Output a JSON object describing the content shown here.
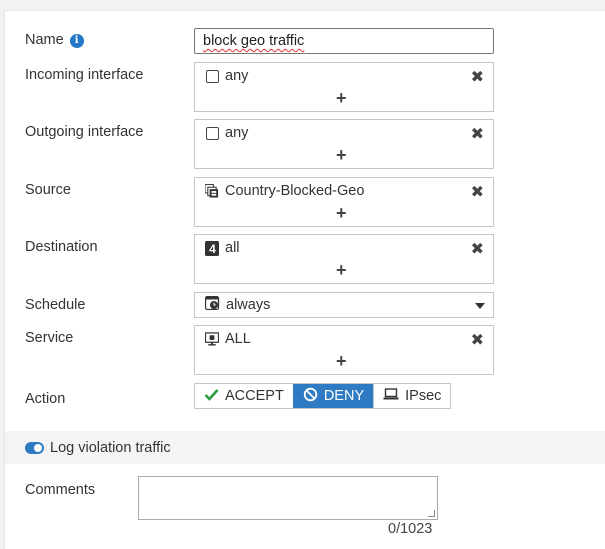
{
  "fields": {
    "name_label": "Name",
    "name_value": "block geo traffic",
    "incoming_label": "Incoming interface",
    "incoming_value": "any",
    "outgoing_label": "Outgoing interface",
    "outgoing_value": "any",
    "source_label": "Source",
    "source_value": "Country-Blocked-Geo",
    "destination_label": "Destination",
    "destination_value": "all",
    "schedule_label": "Schedule",
    "schedule_value": "always",
    "service_label": "Service",
    "service_value": "ALL",
    "action_label": "Action"
  },
  "action_options": [
    {
      "label": "ACCEPT",
      "icon": "check-icon",
      "selected": false
    },
    {
      "label": "DENY",
      "icon": "deny-icon",
      "selected": true
    },
    {
      "label": "IPsec",
      "icon": "laptop-icon",
      "selected": false
    }
  ],
  "log": {
    "label": "Log violation traffic",
    "enabled": true
  },
  "comments": {
    "label": "Comments",
    "counter": "0/1023"
  },
  "controls": {
    "remove_symbol": "✖",
    "add_symbol": "+",
    "info_symbol": "i"
  },
  "colors": {
    "accent": "#2e7bc4",
    "check": "#2a9d3c",
    "info": "#2477c9"
  }
}
